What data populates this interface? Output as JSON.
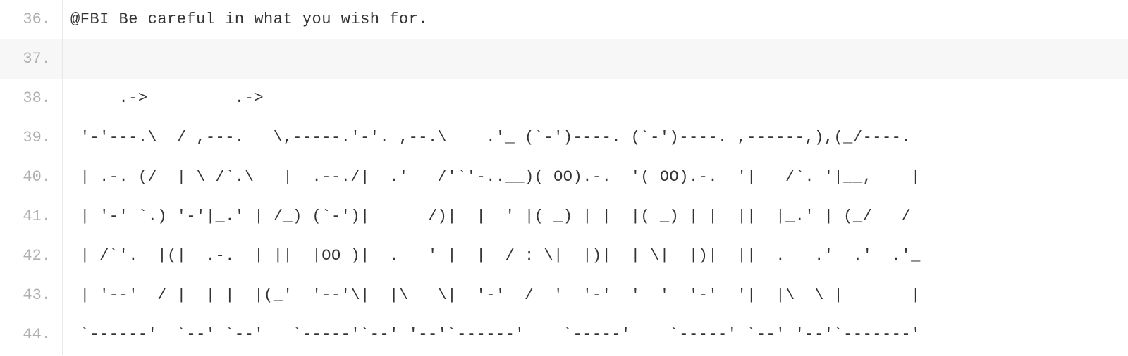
{
  "lines": [
    {
      "num": "36.",
      "text": "@FBI Be careful in what you wish for.",
      "highlight": false
    },
    {
      "num": "37.",
      "text": "",
      "highlight": true
    },
    {
      "num": "38.",
      "text": "     .->         .->",
      "highlight": false
    },
    {
      "num": "39.",
      "text": " '-'---.\\  / ,---.   \\,-----.'-'. ,--.\\    .'_ (`-')----. (`-')----. ,------,),(_/----.",
      "highlight": false
    },
    {
      "num": "40.",
      "text": " | .-. (/  | \\ /`.\\   |  .--./|  .'   /'`'-..__)( OO).-.  '( OO).-.  '|   /`. '|__,    |",
      "highlight": false
    },
    {
      "num": "41.",
      "text": " | '-' `.) '-'|_.' | /_) (`-')|      /)|  |  ' |( _) | |  |( _) | |  ||  |_.' | (_/   /",
      "highlight": false
    },
    {
      "num": "42.",
      "text": " | /`'.  |(|  .-.  | ||  |OO )|  .   ' |  |  / : \\|  |)|  | \\|  |)|  ||  .   .'  .'  .'_",
      "highlight": false
    },
    {
      "num": "43.",
      "text": " | '--'  / |  | |  |(_'  '--'\\|  |\\   \\|  '-'  /  '  '-'  '  '  '-'  '|  |\\  \\ |       |",
      "highlight": false
    },
    {
      "num": "44.",
      "text": " `------'  `--' `--'   `-----'`--' '--'`------'    `-----'    `-----' `--' '--'`-------'",
      "highlight": false
    }
  ]
}
